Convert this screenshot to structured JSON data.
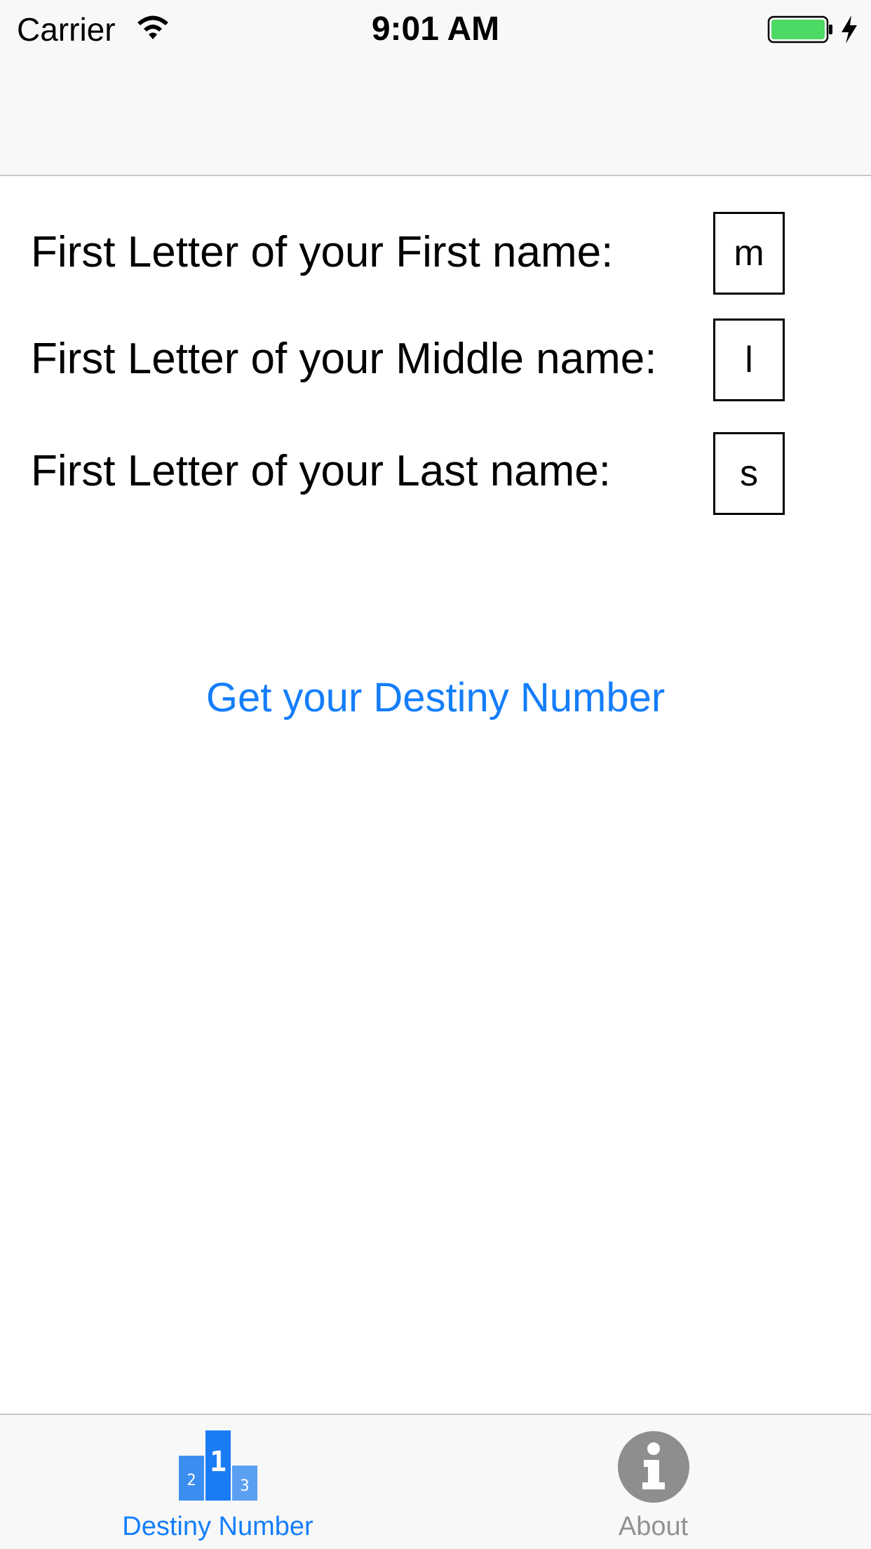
{
  "status_bar": {
    "carrier": "Carrier",
    "time": "9:01 AM",
    "wifi_icon": "wifi-icon",
    "battery_icon": "battery-icon",
    "charging_icon": "bolt-icon",
    "battery_color": "#4cd964"
  },
  "form": {
    "first": {
      "label": "First Letter of your First name:",
      "value": "m"
    },
    "middle": {
      "label": "First Letter of your Middle name:",
      "value": "l"
    },
    "last": {
      "label": "First Letter of your Last name:",
      "value": "s"
    }
  },
  "action": {
    "label": "Get your Destiny Number",
    "color": "#147efb"
  },
  "tab_bar": {
    "tabs": [
      {
        "label": "Destiny Number",
        "icon": "podium-icon",
        "selected": true,
        "color": "#147efb"
      },
      {
        "label": "About",
        "icon": "info-icon",
        "selected": false,
        "color": "#929292"
      }
    ]
  }
}
